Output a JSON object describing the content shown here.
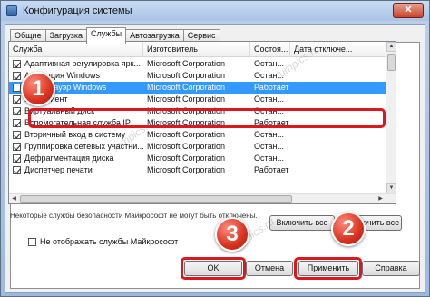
{
  "window": {
    "title": "Конфигурация системы",
    "close_glyph": "✕"
  },
  "tabs": [
    "Общие",
    "Загрузка",
    "Службы",
    "Автозагрузка",
    "Сервис"
  ],
  "active_tab": "Службы",
  "list": {
    "headers": [
      "Служба",
      "Изготовитель",
      "Состоя...",
      "Дата отключе..."
    ],
    "rows": [
      {
        "checked": true,
        "name": "Адаптивная регулировка ярк...",
        "maker": "Microsoft Corporation",
        "state": "Остан...",
        "date": ""
      },
      {
        "checked": true,
        "name": "Активация Windows",
        "maker": "Microsoft Corporation",
        "state": "Остан...",
        "date": ""
      },
      {
        "checked": false,
        "name": "Брандмауэр Windows",
        "maker": "Microsoft Corporation",
        "state": "Работает",
        "date": "",
        "selected": true
      },
      {
        "checked": true,
        "name": "Веб-клиент",
        "maker": "Microsoft Corporation",
        "state": "Остан...",
        "date": ""
      },
      {
        "checked": true,
        "name": "Виртуальный диск",
        "maker": "Microsoft Corporation",
        "state": "Остан...",
        "date": ""
      },
      {
        "checked": true,
        "name": "Вспомогательная служба IP",
        "maker": "Microsoft Corporation",
        "state": "Работает",
        "date": ""
      },
      {
        "checked": true,
        "name": "Вторичный вход в систему",
        "maker": "Microsoft Corporation",
        "state": "Остан...",
        "date": ""
      },
      {
        "checked": true,
        "name": "Группировка сетевых участни...",
        "maker": "Microsoft Corporation",
        "state": "Остан...",
        "date": ""
      },
      {
        "checked": true,
        "name": "Дефрагментация диска",
        "maker": "Microsoft Corporation",
        "state": "Остан...",
        "date": ""
      },
      {
        "checked": true,
        "name": "Диспетчер печати",
        "maker": "Microsoft Corporation",
        "state": "Работает",
        "date": ""
      }
    ]
  },
  "notice": "Некоторые службы безопасности Майкрософт не могут быть отключены.",
  "buttons": {
    "enable_all": "Включить все",
    "disable_all": "Отключить все",
    "ok": "OK",
    "cancel": "Отмена",
    "apply": "Применить",
    "help": "Справка"
  },
  "hide_ms_label": "Не отображать службы Майкрософт",
  "badges": {
    "one": "1",
    "two": "2",
    "three": "3"
  },
  "annotation_color": "#e0161d",
  "watermark": "lumpics.ru"
}
